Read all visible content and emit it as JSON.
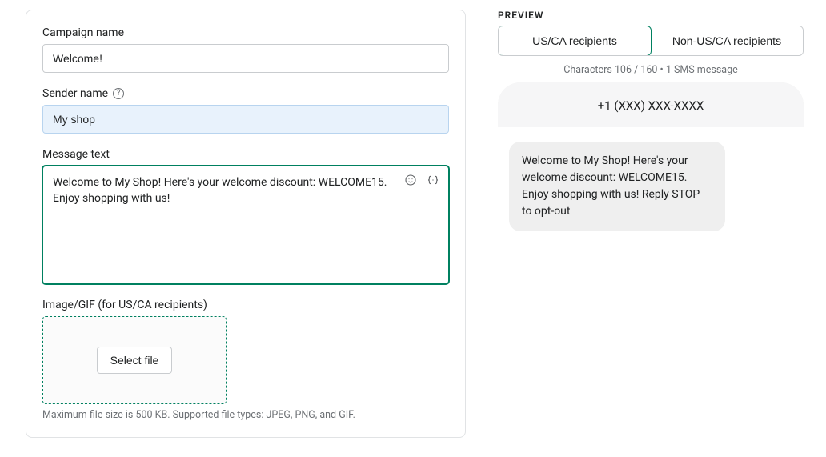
{
  "form": {
    "campaign_name_label": "Campaign name",
    "campaign_name_value": "Welcome!",
    "sender_name_label": "Sender name",
    "sender_name_value": "My shop",
    "message_text_label": "Message text",
    "message_text_value": "Welcome to My Shop! Here's your welcome discount: WELCOME15. Enjoy shopping with us!",
    "image_label": "Image/GIF (for US/CA recipients)",
    "select_file_label": "Select file",
    "image_hint": "Maximum file size is 500 KB. Supported file types: JPEG, PNG, and GIF."
  },
  "preview": {
    "label": "PREVIEW",
    "tab_us": "US/CA recipients",
    "tab_non_us": "Non-US/CA recipients",
    "char_count": "Characters 106 / 160 • 1 SMS message",
    "phone_number": "+1 (XXX) XXX-XXXX",
    "bubble_text": "Welcome to My Shop! Here's your welcome discount: WELCOME15. Enjoy shopping with us! Reply STOP to opt-out"
  },
  "icons": {
    "help": "?",
    "emoji": "emoji-icon",
    "variable": "variable-icon"
  }
}
